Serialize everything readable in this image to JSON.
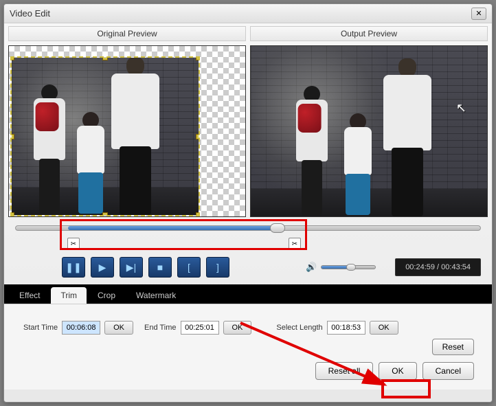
{
  "window": {
    "title": "Video Edit"
  },
  "previews": {
    "original_label": "Original Preview",
    "output_label": "Output Preview"
  },
  "playback": {
    "time_display": "00:24:59 / 00:43:54"
  },
  "tabs": {
    "effect": "Effect",
    "trim": "Trim",
    "crop": "Crop",
    "watermark": "Watermark",
    "active": "trim"
  },
  "trim": {
    "start_label": "Start Time",
    "start_value": "00:06:08",
    "start_ok": "OK",
    "end_label": "End Time",
    "end_value": "00:25:01",
    "end_ok": "OK",
    "select_label": "Select Length",
    "select_value": "00:18:53",
    "select_ok": "OK"
  },
  "buttons": {
    "reset": "Reset",
    "reset_all": "Reset all",
    "ok": "OK",
    "cancel": "Cancel"
  },
  "icons": {
    "close": "✕",
    "pause": "❚❚",
    "play": "▶",
    "next": "▶|",
    "stop": "■",
    "mark_in": "[",
    "mark_out": "]",
    "scissors": "✂",
    "speaker": "🔊",
    "cursor": "↖"
  }
}
